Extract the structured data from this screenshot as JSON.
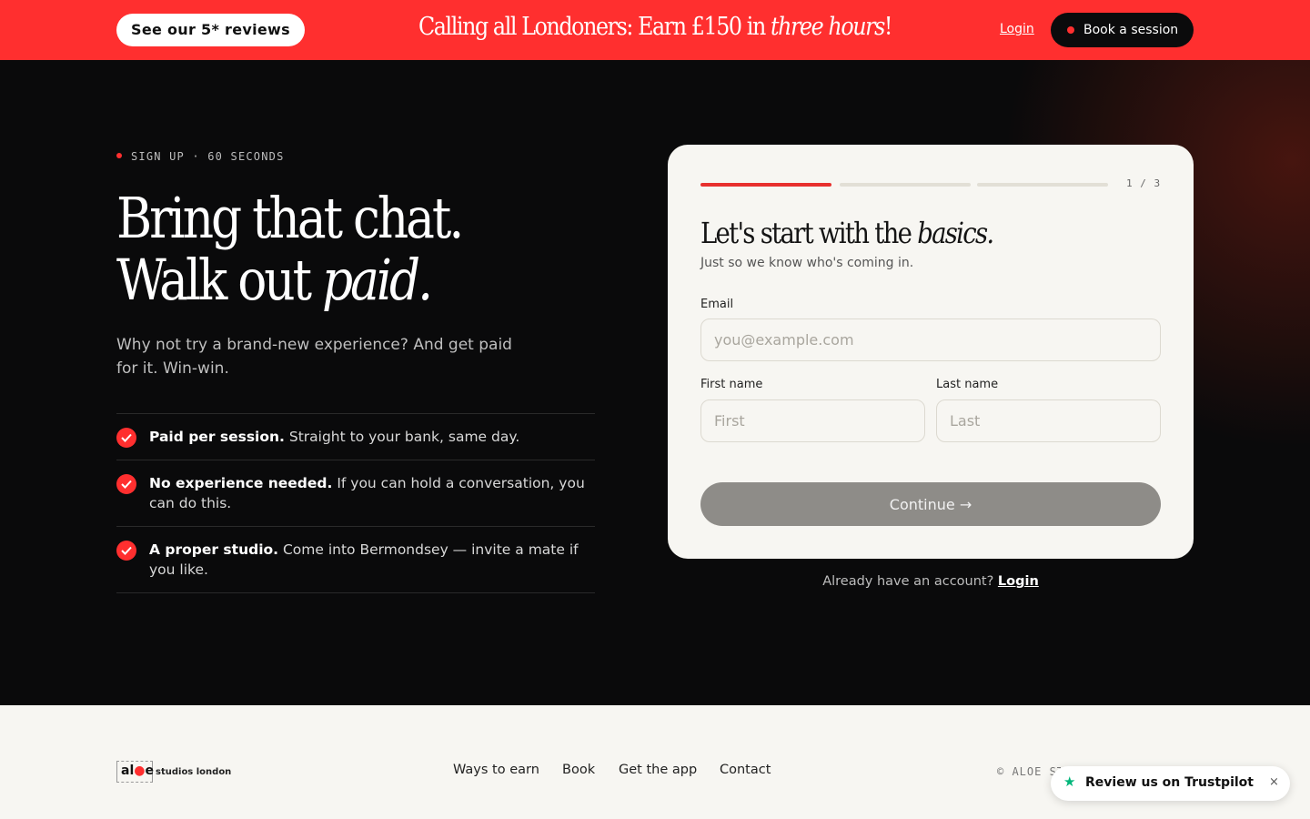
{
  "topbar": {
    "reviews_label": "See our 5* reviews",
    "promo_prefix": "Calling all Londoners: Earn £150 in ",
    "promo_emphasis": "three hours",
    "promo_suffix": "!",
    "login_label": "Login",
    "book_label": "Book a session"
  },
  "hero": {
    "kicker": "SIGN UP · 60 SECONDS",
    "headline_line1": "Bring that chat.",
    "headline_line2_prefix": "Walk out ",
    "headline_line2_emphasis": "paid.",
    "subtext": "Why not try a brand-new experience? And get paid for it. Win-win.",
    "benefits": [
      {
        "title": "Paid per session.",
        "text": " Straight to your bank, same day."
      },
      {
        "title": "No experience needed.",
        "text": " If you can hold a conversation, you can do this."
      },
      {
        "title": "A proper studio.",
        "text": " Come into Bermondsey — invite a mate if you like."
      }
    ]
  },
  "form": {
    "step": "1 / 3",
    "progress_step": 1,
    "progress_total": 3,
    "title_prefix": "Let's start with the ",
    "title_emphasis": "basics.",
    "subtitle": "Just so we know who's coming in.",
    "email_label": "Email",
    "email_placeholder": "you@example.com",
    "first_label": "First name",
    "first_placeholder": "First",
    "last_label": "Last name",
    "last_placeholder": "Last",
    "continue_label": "Continue →",
    "already_text": "Already have an account? ",
    "already_link": "Login"
  },
  "footer": {
    "logo_prefix": "al",
    "logo_accent": "●",
    "logo_suffix": "e",
    "logo_tag": "studios london",
    "nav": [
      "Ways to earn",
      "Book",
      "Get the app",
      "Contact"
    ],
    "copyright": "© ALOE ST"
  },
  "trustpilot": {
    "label": "Review us on Trustpilot",
    "close": "×"
  },
  "colors": {
    "accent": "#ff2f2f",
    "trustpilot_green": "#00b67a"
  }
}
